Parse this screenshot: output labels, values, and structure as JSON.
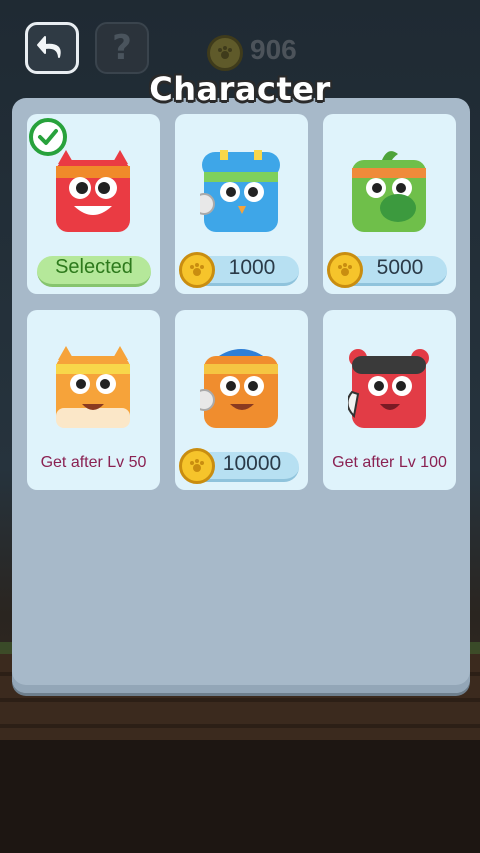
{
  "header": {
    "title": "Character",
    "coin_count": "906",
    "back_icon": "undo-arrow-icon",
    "help_label": "?"
  },
  "characters": [
    {
      "id": "red",
      "status": "Selected",
      "price": "",
      "body": "#ea3b43",
      "band": "#f08a2a",
      "ears": "cat",
      "selected": true
    },
    {
      "id": "blue",
      "status": "",
      "price": "1000",
      "body": "#3ea6e8",
      "band": "#7fd05c",
      "ears": "helmet",
      "selected": false
    },
    {
      "id": "green",
      "status": "",
      "price": "5000",
      "body": "#6fbf4a",
      "band": "#ef8b3a",
      "ears": "leaf",
      "selected": false
    },
    {
      "id": "orange-cat",
      "status": "Get after  Lv 50",
      "price": "",
      "body": "#f6a33a",
      "band": "#f8d74a",
      "ears": "cat",
      "selected": false
    },
    {
      "id": "orange",
      "status": "",
      "price": "10000",
      "body": "#f08d2e",
      "band": "#2f7fd6",
      "ears": "cap",
      "selected": false
    },
    {
      "id": "red-bear",
      "status": "Get after  Lv 100",
      "price": "",
      "body": "#e23c46",
      "band": "#3a3a3a",
      "ears": "bear",
      "selected": false
    }
  ]
}
